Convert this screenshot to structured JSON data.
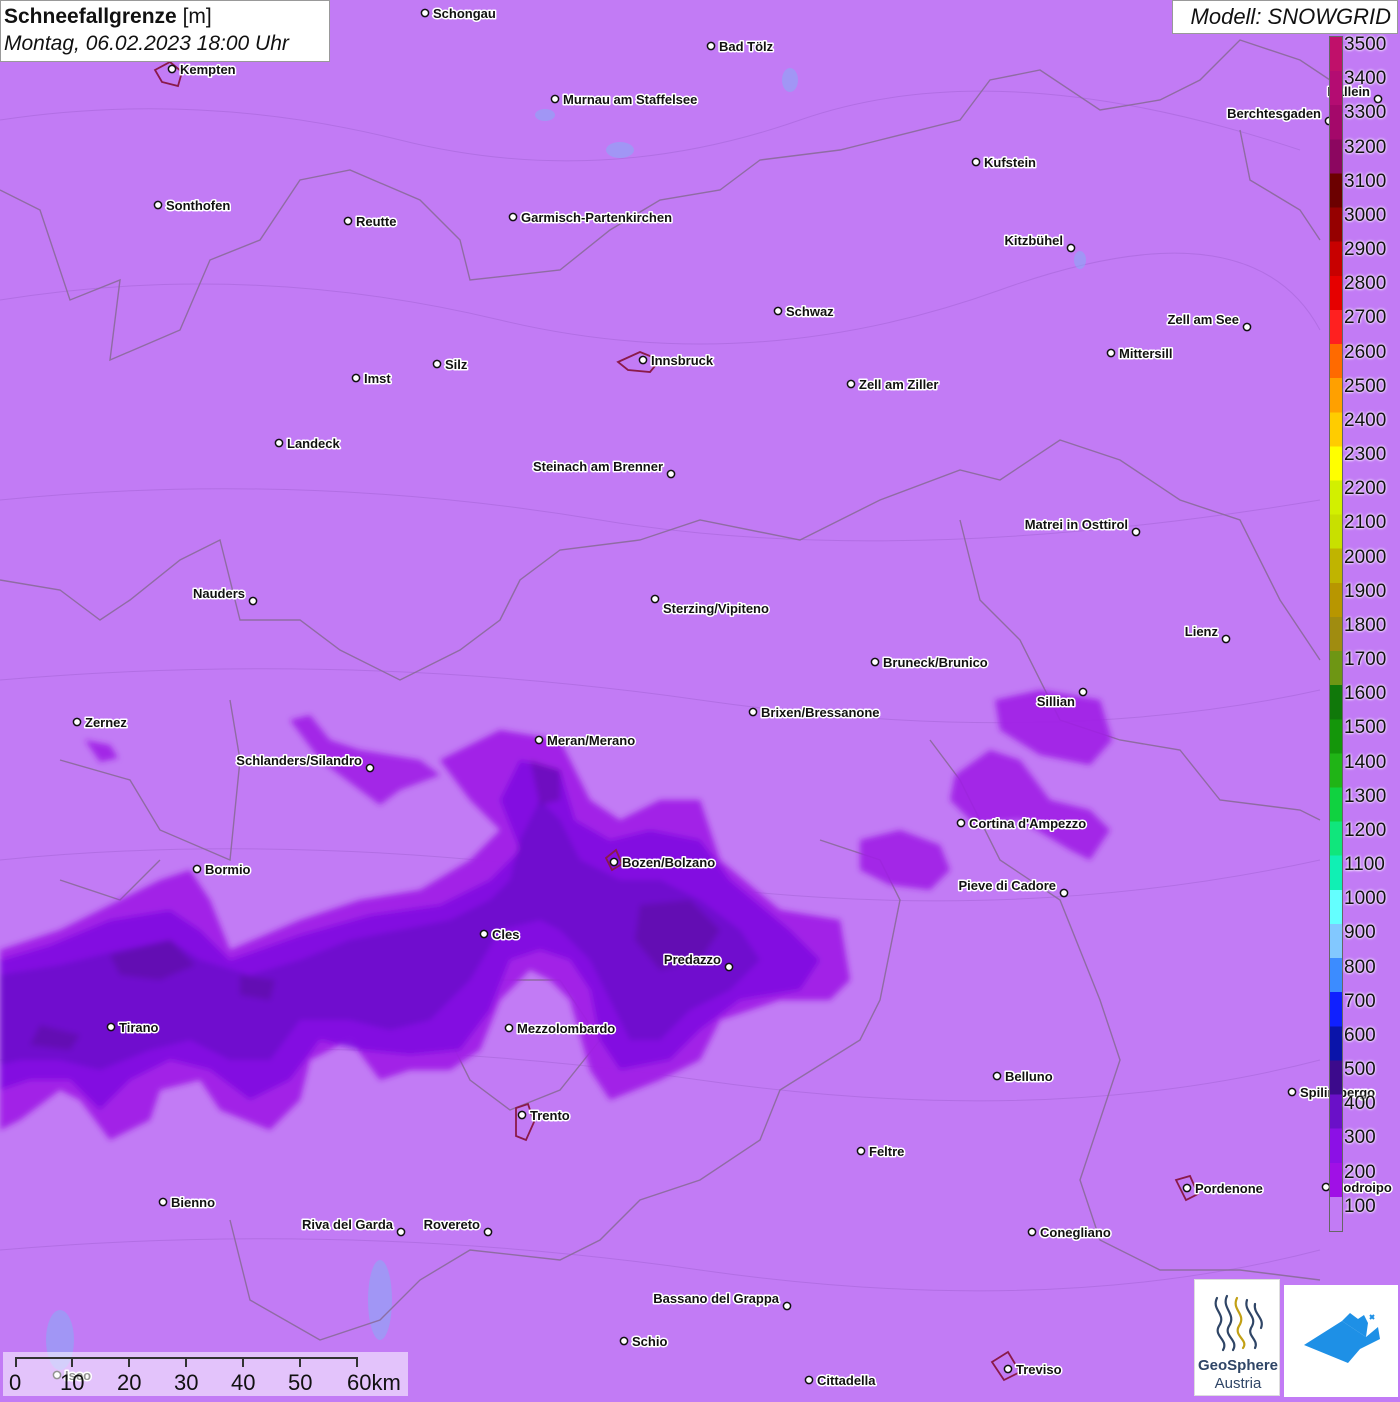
{
  "title": {
    "label": "Schneefallgrenze",
    "unit": "[m]",
    "datetime": "Montag, 06.02.2023 18:00 Uhr"
  },
  "model_label": "Modell: SNOWGRID",
  "legend": {
    "labels": [
      "3500",
      "3400",
      "3300",
      "3200",
      "3100",
      "3000",
      "2900",
      "2800",
      "2700",
      "2600",
      "2500",
      "2400",
      "2300",
      "2200",
      "2100",
      "2000",
      "1900",
      "1800",
      "1700",
      "1600",
      "1500",
      "1400",
      "1300",
      "1200",
      "1100",
      "1000",
      "900",
      "800",
      "700",
      "600",
      "500",
      "400",
      "300",
      "200",
      "100"
    ],
    "colors": [
      "#c0106a",
      "#b40c72",
      "#a4086a",
      "#8c0660",
      "#6c0000",
      "#960000",
      "#c80000",
      "#e60000",
      "#ff2020",
      "#ff6a00",
      "#ffa000",
      "#ffcc00",
      "#ffff00",
      "#d2f000",
      "#c8e000",
      "#c0b400",
      "#b89600",
      "#a08c10",
      "#6e9614",
      "#10780a",
      "#14960a",
      "#20b416",
      "#10d240",
      "#10e67c",
      "#10f0b4",
      "#64ffff",
      "#82c8ff",
      "#3c8cff",
      "#1020ff",
      "#0a14aa",
      "#3c0a8c",
      "#6a10c8",
      "#8c10e6",
      "#a010e6",
      "#c27bf5"
    ]
  },
  "scale": {
    "labels": [
      "0",
      "10",
      "20",
      "30",
      "40",
      "50",
      "60km"
    ]
  },
  "cities": [
    {
      "name": "Schongau"
    },
    {
      "name": "Kempten"
    },
    {
      "name": "Bad Tölz"
    },
    {
      "name": "Murnau am Staffelsee"
    },
    {
      "name": "Hallein"
    },
    {
      "name": "Berchtesgaden"
    },
    {
      "name": "Kufstein"
    },
    {
      "name": "Sonthofen"
    },
    {
      "name": "Reutte"
    },
    {
      "name": "Garmisch-Partenkirchen"
    },
    {
      "name": "Kitzbühel"
    },
    {
      "name": "Schwaz"
    },
    {
      "name": "Zell am See"
    },
    {
      "name": "Innsbruck"
    },
    {
      "name": "Mittersill"
    },
    {
      "name": "Silz"
    },
    {
      "name": "Imst"
    },
    {
      "name": "Zell am Ziller"
    },
    {
      "name": "Landeck"
    },
    {
      "name": "Steinach am Brenner"
    },
    {
      "name": "Matrei in Osttirol"
    },
    {
      "name": "Nauders"
    },
    {
      "name": "Sterzing/Vipiteno"
    },
    {
      "name": "Lienz"
    },
    {
      "name": "Bruneck/Brunico"
    },
    {
      "name": "Sillian"
    },
    {
      "name": "Brixen/Bressanone"
    },
    {
      "name": "Zernez"
    },
    {
      "name": "Meran/Merano"
    },
    {
      "name": "Schlanders/Silandro"
    },
    {
      "name": "Cortina d'Ampezzo"
    },
    {
      "name": "Bozen/Bolzano"
    },
    {
      "name": "Bormio"
    },
    {
      "name": "Pieve di Cadore"
    },
    {
      "name": "Cles"
    },
    {
      "name": "Predazzo"
    },
    {
      "name": "Tirano"
    },
    {
      "name": "Mezzolombardo"
    },
    {
      "name": "Belluno"
    },
    {
      "name": "Spilimbergo"
    },
    {
      "name": "Trento"
    },
    {
      "name": "Feltre"
    },
    {
      "name": "Pordenone"
    },
    {
      "name": "Codroipo"
    },
    {
      "name": "Bienno"
    },
    {
      "name": "Riva del Garda"
    },
    {
      "name": "Rovereto"
    },
    {
      "name": "Conegliano"
    },
    {
      "name": "Bassano del Grappa"
    },
    {
      "name": "Schio"
    },
    {
      "name": "Treviso"
    },
    {
      "name": "Cittadella"
    },
    {
      "name": "Iseo"
    }
  ],
  "logos": {
    "geosphere_line1": "GeoSphere",
    "geosphere_line2": "Austria"
  }
}
